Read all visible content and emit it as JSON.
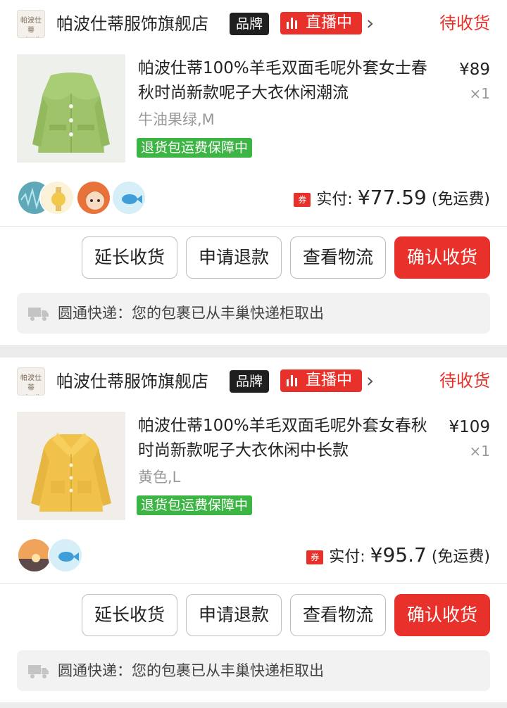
{
  "orders": [
    {
      "shop_logo_top": "帕波仕蒂",
      "shop_logo_bottom": "pobosity",
      "shop_name": "帕波仕蒂服饰旗舰店",
      "brand_badge": "品牌",
      "live_badge": "直播中",
      "status": "待收货",
      "product_title": "帕波仕蒂100%羊毛双面毛呢外套女士春秋时尚新款呢子大衣休闲潮流",
      "price": "¥89",
      "quantity": "×1",
      "sku": "牛油果绿,M",
      "guarantee": "退货包运费保障中",
      "product_color": "#9fc36a",
      "avatars": [
        "waveform-avatar",
        "watch-avatar",
        "cartoon-girl-avatar",
        "fish-avatar"
      ],
      "paid_label": "实付:",
      "paid_amount": "¥77.59",
      "paid_note": "(免运费)",
      "coupon_label": "券",
      "buttons": {
        "extend": "延长收货",
        "refund": "申请退款",
        "logistics": "查看物流",
        "confirm": "确认收货"
      },
      "logistics_text": "圆通快递：您的包裹已从丰巢快递柜取出"
    },
    {
      "shop_logo_top": "帕波仕蒂",
      "shop_logo_bottom": "pobosity",
      "shop_name": "帕波仕蒂服饰旗舰店",
      "brand_badge": "品牌",
      "live_badge": "直播中",
      "status": "待收货",
      "product_title": "帕波仕蒂100%羊毛双面毛呢外套女春秋时尚新款呢子大衣休闲中长款",
      "price": "¥109",
      "quantity": "×1",
      "sku": "黄色,L",
      "guarantee": "退货包运费保障中",
      "product_color": "#f0c24a",
      "avatars": [
        "sunset-avatar",
        "fish-avatar"
      ],
      "paid_label": "实付:",
      "paid_amount": "¥95.7",
      "paid_note": "(免运费)",
      "coupon_label": "券",
      "buttons": {
        "extend": "延长收货",
        "refund": "申请退款",
        "logistics": "查看物流",
        "confirm": "确认收货"
      },
      "logistics_text": "圆通快递：您的包裹已从丰巢快递柜取出"
    }
  ],
  "colors": {
    "accent": "#e8312a",
    "guarantee_green": "#3db544",
    "brand_black": "#1f1f1f"
  }
}
